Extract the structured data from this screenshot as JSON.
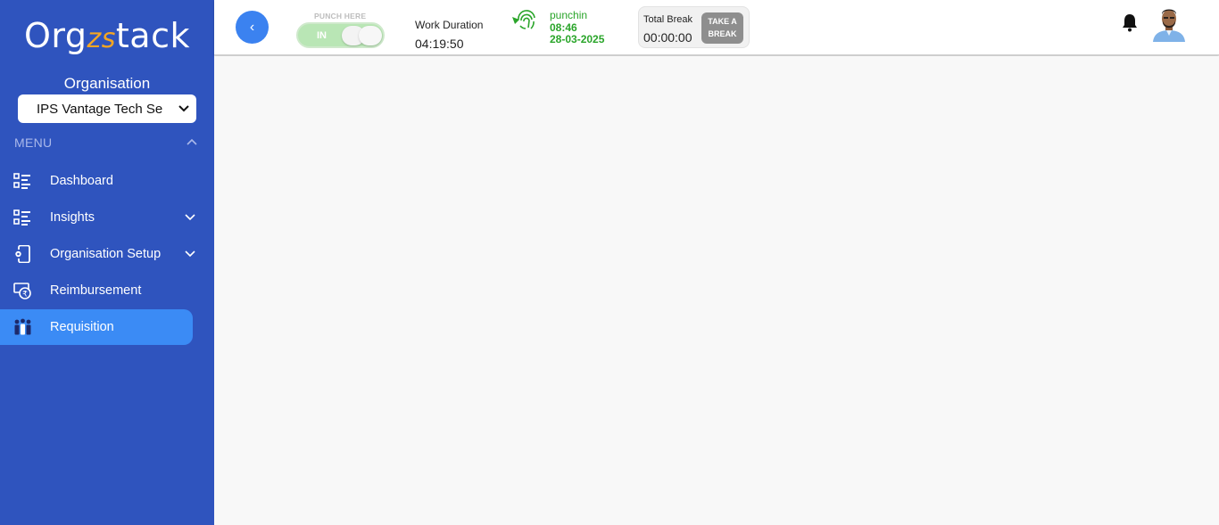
{
  "brand": {
    "logo_pre": "Org",
    "logo_mid": "zs",
    "logo_post": "tack"
  },
  "sidebar": {
    "org_label": "Organisation",
    "org_select_value": "IPS Vantage Tech Se",
    "menu_header": "MENU",
    "items": [
      {
        "label": "Dashboard",
        "icon": "list-icon"
      },
      {
        "label": "Insights",
        "icon": "list-icon"
      },
      {
        "label": "Organisation Setup",
        "icon": "phone-settings-icon"
      },
      {
        "label": "Reimbursement",
        "icon": "rupee-refund-icon"
      },
      {
        "label": "Requisition",
        "icon": "people-icon",
        "active": true
      }
    ]
  },
  "topbar": {
    "back_label": "‹",
    "punch_label": "PUNCH HERE",
    "punch_state": "IN",
    "work_duration_label": "Work Duration",
    "work_duration_value": "04:19:50",
    "punch_status": "punchin",
    "punch_time": "08:46",
    "punch_date": "28-03-2025",
    "total_break_label": "Total Break",
    "total_break_value": "00:00:00",
    "take_break_line1": "TAKE A",
    "take_break_line2": "BREAK"
  },
  "colors": {
    "sidebar_bg": "#2f54be",
    "active_item": "#3b8bf5",
    "punch_green": "#2aa52a"
  }
}
